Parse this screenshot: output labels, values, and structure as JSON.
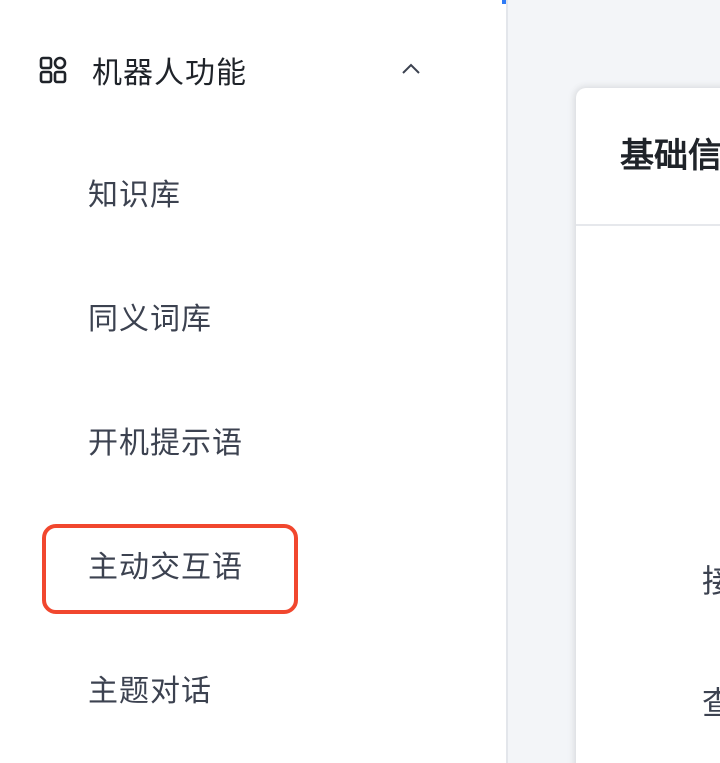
{
  "sidebar": {
    "group": {
      "label": "机器人功能",
      "icon": "grid-icon",
      "expand_icon": "chevron-up-icon"
    },
    "items": [
      {
        "label": "知识库"
      },
      {
        "label": "同义词库"
      },
      {
        "label": "开机提示语"
      },
      {
        "label": "主动交互语",
        "highlighted": true
      },
      {
        "label": "主题对话"
      }
    ]
  },
  "main": {
    "card_title": "基础信",
    "fragments": [
      "接",
      "查"
    ]
  },
  "colors": {
    "accent": "#2f7bf6",
    "highlight": "#f1472e",
    "text": "#3c4250",
    "title": "#1f2329"
  }
}
